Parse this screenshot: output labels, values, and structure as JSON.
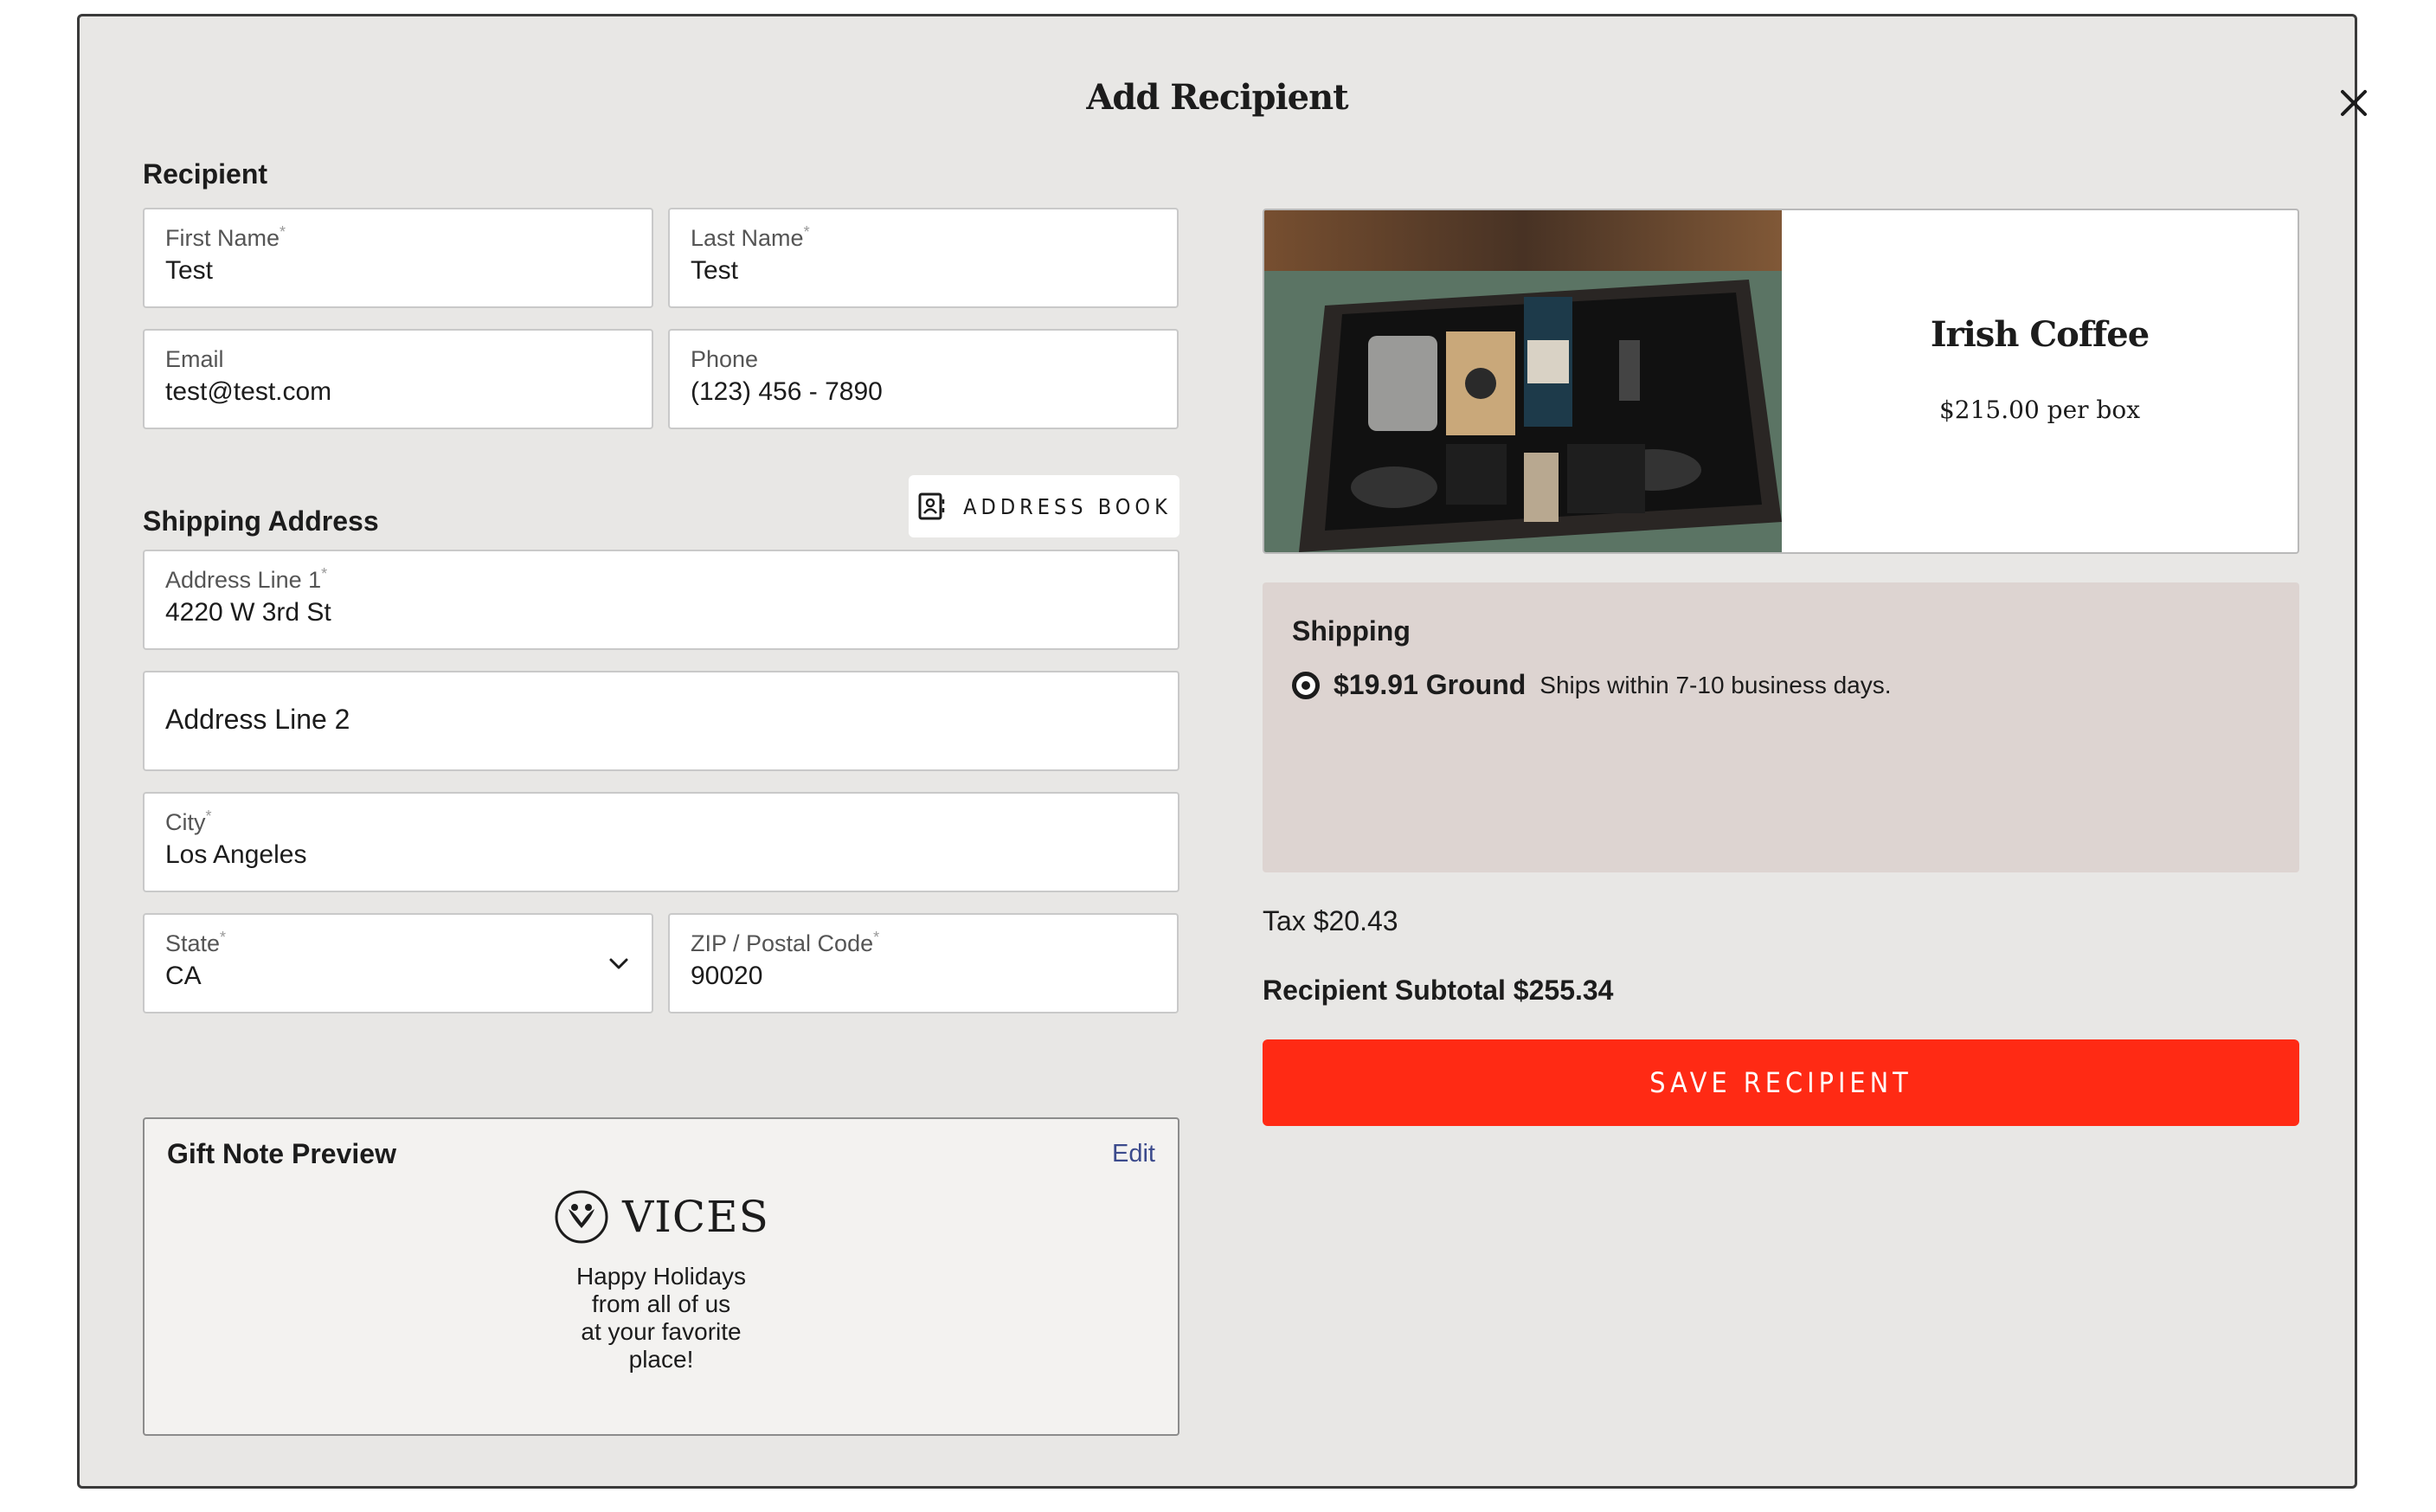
{
  "modal": {
    "title": "Add Recipient",
    "close_icon": "close-icon"
  },
  "recipient": {
    "section_label": "Recipient",
    "first_name": {
      "label": "First Name",
      "value": "Test"
    },
    "last_name": {
      "label": "Last Name",
      "value": "Test"
    },
    "email": {
      "label": "Email",
      "value": "test@test.com"
    },
    "phone": {
      "label": "Phone",
      "value": "(123) 456 - 7890"
    }
  },
  "shipping_address": {
    "section_label": "Shipping Address",
    "address_book_label": "ADDRESS BOOK",
    "address_line1": {
      "label": "Address Line 1",
      "value": "4220 W 3rd St"
    },
    "address_line2": {
      "placeholder": "Address Line 2"
    },
    "city": {
      "label": "City",
      "value": "Los Angeles"
    },
    "state": {
      "label": "State",
      "value": "CA"
    },
    "zip": {
      "label": "ZIP / Postal Code",
      "value": "90020"
    },
    "required_mark": "*"
  },
  "gift_note": {
    "heading": "Gift Note Preview",
    "edit_label": "Edit",
    "brand": "VICES",
    "message_lines": [
      "Happy Holidays",
      "from all of us",
      "at your favorite",
      "place!"
    ]
  },
  "product": {
    "name": "Irish Coffee",
    "price": "$215.00 per box"
  },
  "shipping": {
    "heading": "Shipping",
    "option_price": "$19.91 Ground",
    "option_desc": "Ships within 7-10 business days."
  },
  "totals": {
    "tax": "Tax $20.43",
    "subtotal": "Recipient Subtotal $255.34"
  },
  "actions": {
    "save_label": "SAVE RECIPIENT"
  },
  "colors": {
    "modal_bg": "#e8e7e5",
    "shipping_bg": "#ddd4d1",
    "save_button": "#ff2a14",
    "edit_link": "#3b4a8c"
  }
}
